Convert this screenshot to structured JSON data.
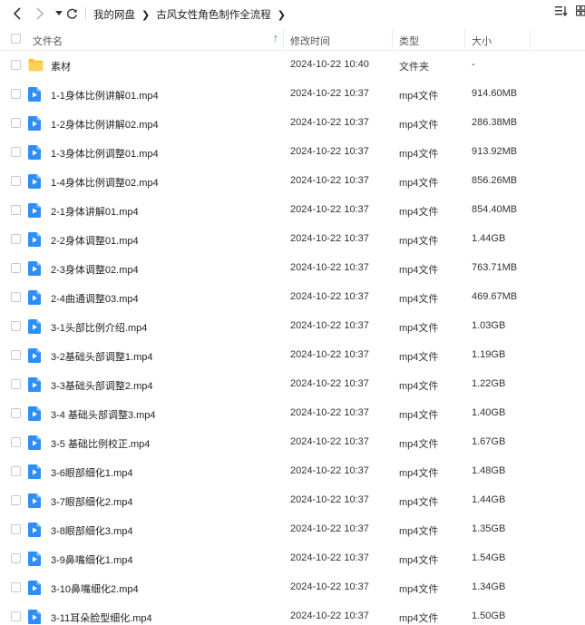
{
  "breadcrumb": [
    "我的网盘",
    "古风女性角色制作全流程"
  ],
  "columns": {
    "name": "文件名",
    "modified": "修改时间",
    "type": "类型",
    "size": "大小"
  },
  "files": [
    {
      "name": "素材",
      "date": "2024-10-22 10:40",
      "type": "文件夹",
      "size": "-",
      "icon": "folder-icon"
    },
    {
      "name": "1-1身体比例讲解01.mp4",
      "date": "2024-10-22 10:37",
      "type": "mp4文件",
      "size": "914.60MB",
      "icon": "video-file-icon"
    },
    {
      "name": "1-2身体比例讲解02.mp4",
      "date": "2024-10-22 10:37",
      "type": "mp4文件",
      "size": "286.38MB",
      "icon": "video-file-icon"
    },
    {
      "name": "1-3身体比例调整01.mp4",
      "date": "2024-10-22 10:37",
      "type": "mp4文件",
      "size": "913.92MB",
      "icon": "video-file-icon"
    },
    {
      "name": "1-4身体比例调整02.mp4",
      "date": "2024-10-22 10:37",
      "type": "mp4文件",
      "size": "856.26MB",
      "icon": "video-file-icon"
    },
    {
      "name": "2-1身体讲解01.mp4",
      "date": "2024-10-22 10:37",
      "type": "mp4文件",
      "size": "854.40MB",
      "icon": "video-file-icon"
    },
    {
      "name": "2-2身体调整01.mp4",
      "date": "2024-10-22 10:37",
      "type": "mp4文件",
      "size": "1.44GB",
      "icon": "video-file-icon"
    },
    {
      "name": "2-3身体调整02.mp4",
      "date": "2024-10-22 10:37",
      "type": "mp4文件",
      "size": "763.71MB",
      "icon": "video-file-icon"
    },
    {
      "name": "2-4曲通调整03.mp4",
      "date": "2024-10-22 10:37",
      "type": "mp4文件",
      "size": "469.67MB",
      "icon": "video-file-icon"
    },
    {
      "name": "3-1头部比例介绍.mp4",
      "date": "2024-10-22 10:37",
      "type": "mp4文件",
      "size": "1.03GB",
      "icon": "video-file-icon"
    },
    {
      "name": "3-2基础头部调整1.mp4",
      "date": "2024-10-22 10:37",
      "type": "mp4文件",
      "size": "1.19GB",
      "icon": "video-file-icon"
    },
    {
      "name": "3-3基础头部调整2.mp4",
      "date": "2024-10-22 10:37",
      "type": "mp4文件",
      "size": "1.22GB",
      "icon": "video-file-icon"
    },
    {
      "name": "3-4 基础头部调整3.mp4",
      "date": "2024-10-22 10:37",
      "type": "mp4文件",
      "size": "1.40GB",
      "icon": "video-file-icon"
    },
    {
      "name": "3-5 基础比例校正.mp4",
      "date": "2024-10-22 10:37",
      "type": "mp4文件",
      "size": "1.67GB",
      "icon": "video-file-icon"
    },
    {
      "name": "3-6眼部细化1.mp4",
      "date": "2024-10-22 10:37",
      "type": "mp4文件",
      "size": "1.48GB",
      "icon": "video-file-icon"
    },
    {
      "name": "3-7眼部细化2.mp4",
      "date": "2024-10-22 10:37",
      "type": "mp4文件",
      "size": "1.44GB",
      "icon": "video-file-icon"
    },
    {
      "name": "3-8眼部细化3.mp4",
      "date": "2024-10-22 10:37",
      "type": "mp4文件",
      "size": "1.35GB",
      "icon": "video-file-icon"
    },
    {
      "name": "3-9鼻嘴细化1.mp4",
      "date": "2024-10-22 10:37",
      "type": "mp4文件",
      "size": "1.54GB",
      "icon": "video-file-icon"
    },
    {
      "name": "3-10鼻嘴细化2.mp4",
      "date": "2024-10-22 10:37",
      "type": "mp4文件",
      "size": "1.34GB",
      "icon": "video-file-icon"
    },
    {
      "name": "3-11耳朵脸型细化.mp4",
      "date": "2024-10-22 10:37",
      "type": "mp4文件",
      "size": "1.50GB",
      "icon": "video-file-icon"
    }
  ],
  "colors": {
    "accent": "#2e8ef7",
    "folder": "#f9c23c"
  }
}
